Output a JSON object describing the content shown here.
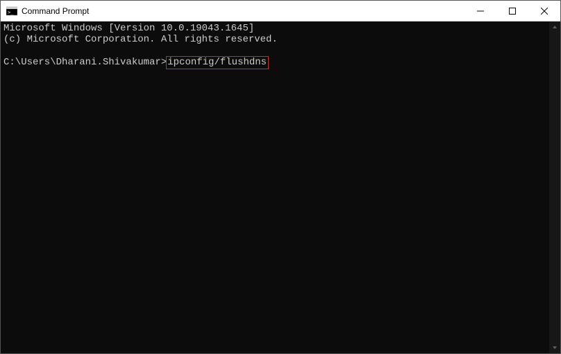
{
  "window": {
    "title": "Command Prompt"
  },
  "console": {
    "line1": "Microsoft Windows [Version 10.0.19043.1645]",
    "line2": "(c) Microsoft Corporation. All rights reserved.",
    "blank": "",
    "prompt": "C:\\Users\\Dharani.Shivakumar>",
    "command": "ipconfig/flushdns"
  }
}
